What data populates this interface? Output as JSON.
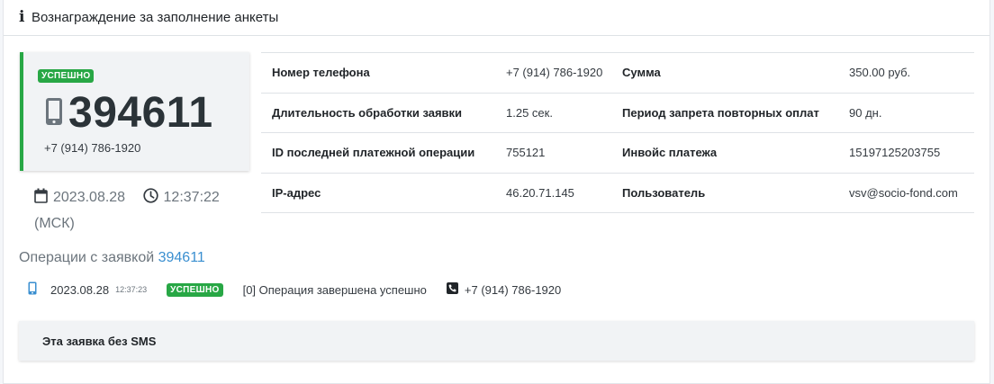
{
  "header": {
    "info_icon": "info-icon",
    "title": "Вознаграждение за заполнение анкеты"
  },
  "summary": {
    "status": "УСПЕШНО",
    "code": "394611",
    "phone": "+7 (914) 786-1920",
    "date": "2023.08.28",
    "time": "12:37:22",
    "timezone": "(МСК)",
    "accent_color": "#28a745"
  },
  "details": {
    "rows": [
      {
        "label1": "Номер телефона",
        "value1": "+7 (914) 786-1920",
        "label2": "Сумма",
        "value2": "350.00 руб."
      },
      {
        "label1": "Длительность обработки заявки",
        "value1": "1.25 сек.",
        "label2": "Период запрета повторных оплат",
        "value2": "90 дн."
      },
      {
        "label1": "ID последней платежной операции",
        "value1": "755121",
        "label2": "Инвойс платежа",
        "value2": "15197125203755"
      },
      {
        "label1": "IP-адрес",
        "value1": "46.20.71.145",
        "label2": "Пользователь",
        "value2": "vsv@socio-fond.com"
      }
    ]
  },
  "operations": {
    "title": "Операции с заявкой",
    "link": "394611",
    "items": [
      {
        "device_icon": "mobile-phone-icon",
        "date": "2023.08.28",
        "time": "12:37:23",
        "status": "УСПЕШНО",
        "message": "[0] Операция завершена успешно",
        "phone_icon": "phone-square-icon",
        "phone": "+7 (914) 786-1920"
      }
    ]
  },
  "sms": {
    "text": "Эта заявка без SMS"
  }
}
